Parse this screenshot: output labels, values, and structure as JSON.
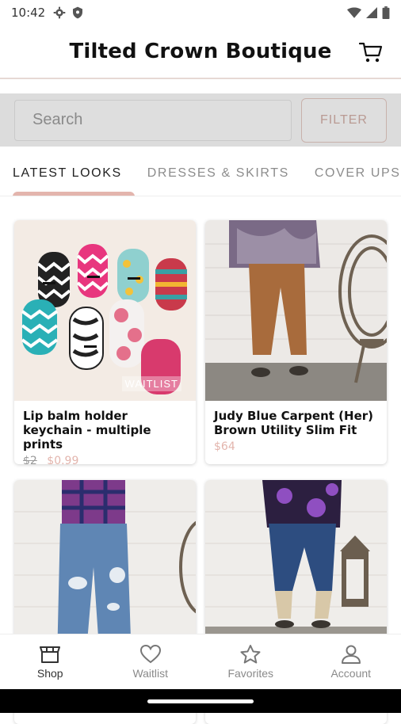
{
  "status_bar": {
    "time": "10:42"
  },
  "header": {
    "title": "Tilted Crown Boutique"
  },
  "search": {
    "placeholder": "Search",
    "filter_label": "FILTER"
  },
  "tabs": [
    {
      "label": "LATEST LOOKS",
      "active": true
    },
    {
      "label": "DRESSES & SKIRTS",
      "active": false
    },
    {
      "label": "COVER UPS",
      "active": false
    }
  ],
  "products": [
    {
      "name": "Lip balm holder keychain - multiple prints",
      "old_price": "$2",
      "price": "$0.99",
      "tag": "WAITLIST"
    },
    {
      "name": "Judy Blue Carpent (Her) Brown Utility Slim Fit",
      "price": "$64"
    },
    {
      "name": ""
    },
    {
      "name": ""
    }
  ],
  "bottom_nav": [
    {
      "label": "Shop",
      "icon": "shop-icon",
      "active": true
    },
    {
      "label": "Waitlist",
      "icon": "heart-icon",
      "active": false
    },
    {
      "label": "Favorites",
      "icon": "star-icon",
      "active": false
    },
    {
      "label": "Account",
      "icon": "person-icon",
      "active": false
    }
  ],
  "colors": {
    "accent": "#e3b5ad",
    "filter_border": "#c8b1ab",
    "search_band": "#dcdcdc"
  }
}
